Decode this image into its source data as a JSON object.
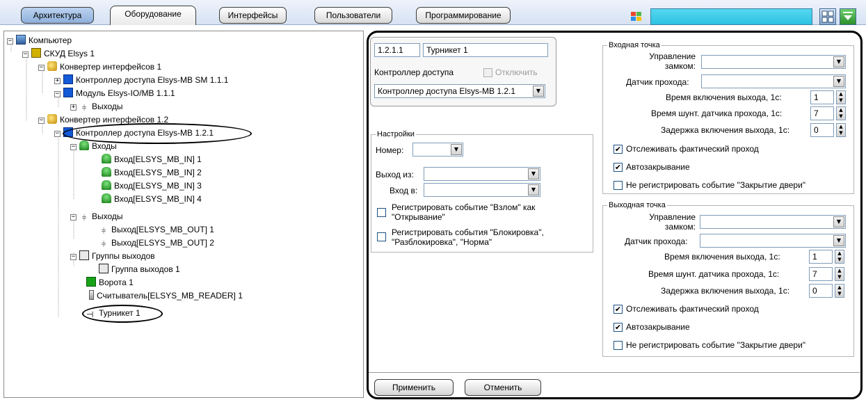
{
  "toolbar": {
    "tabs": [
      {
        "label": "Архитектура"
      },
      {
        "label": "Оборудование"
      },
      {
        "label": "Интерфейсы"
      },
      {
        "label": "Пользователи"
      },
      {
        "label": "Программирование"
      }
    ],
    "accent_color": "#2ec2e2"
  },
  "tree": {
    "items": [
      {
        "label": "Компьютер",
        "icon": "computer-icon"
      },
      {
        "label": "СКУД Elsys 1",
        "icon": "skud-icon"
      },
      {
        "label": "Конвертер интерфейсов 1",
        "icon": "converter-icon"
      },
      {
        "label": "Контроллер доступа Elsys-MB SM 1.1.1",
        "icon": "controller-icon"
      },
      {
        "label": "Модуль Elsys-IO/MB 1.1.1",
        "icon": "module-icon"
      },
      {
        "label": "Выходы",
        "icon": "outputs-icon"
      },
      {
        "label": "Конвертер интерфейсов 1.2",
        "icon": "converter-icon"
      },
      {
        "label": "Контроллер доступа Elsys-MB 1.2.1",
        "icon": "controller-icon"
      },
      {
        "label": "Входы",
        "icon": "inputs-icon"
      },
      {
        "label": "Вход[ELSYS_MB_IN] 1",
        "icon": "input-icon"
      },
      {
        "label": "Вход[ELSYS_MB_IN] 2",
        "icon": "input-icon"
      },
      {
        "label": "Вход[ELSYS_MB_IN] 3",
        "icon": "input-icon"
      },
      {
        "label": "Вход[ELSYS_MB_IN] 4",
        "icon": "input-icon"
      },
      {
        "label": "Выходы",
        "icon": "outputs-icon"
      },
      {
        "label": "Выход[ELSYS_MB_OUT] 1",
        "icon": "output-icon"
      },
      {
        "label": "Выход[ELSYS_MB_OUT] 2",
        "icon": "output-icon"
      },
      {
        "label": "Группы выходов",
        "icon": "output-groups-icon"
      },
      {
        "label": "Группа выходов 1",
        "icon": "output-group-icon"
      },
      {
        "label": "Ворота 1",
        "icon": "gate-icon"
      },
      {
        "label": "Считыватель[ELSYS_MB_READER] 1",
        "icon": "reader-icon"
      },
      {
        "label": "Турникет 1",
        "icon": "turnstile-icon"
      }
    ]
  },
  "object": {
    "id": "1.2.1.1",
    "name": "Турникет 1",
    "controller_label": "Контроллер доступа",
    "disable_label": "Отключить",
    "controller_value": "Контроллер доступа Elsys-MB 1.2.1"
  },
  "settings": {
    "title": "Настройки",
    "number_label": "Номер:",
    "number_value": "",
    "exit_from_label": "Выход из:",
    "exit_from_value": "",
    "entry_to_label": "Вход в:",
    "entry_to_value": "",
    "register_break_label": "Регистрировать событие \"Взлом\" как \"Открывание\"",
    "register_block_label": "Регистрировать события \"Блокировка\", \"Разблокировка\", \"Норма\""
  },
  "entry_point": {
    "title": "Входная точка",
    "lock_label": "Управление замком:",
    "sensor_label": "Датчик прохода:",
    "on_time_label": "Время включения выхода, 1с:",
    "on_time_value": "1",
    "shunt_time_label": "Время шунт. датчика прохода, 1с:",
    "shunt_time_value": "7",
    "delay_label": "Задержка включения выхода, 1с:",
    "delay_value": "0",
    "track_label": "Отслеживать фактический проход",
    "autoclose_label": "Автозакрывание",
    "no_register_label": "Не регистрировать событие \"Закрытие двери\""
  },
  "exit_point": {
    "title": "Выходная точка",
    "lock_label": "Управление замком:",
    "sensor_label": "Датчик прохода:",
    "on_time_label": "Время включения выхода, 1с:",
    "on_time_value": "1",
    "shunt_time_label": "Время шунт. датчика прохода, 1с:",
    "shunt_time_value": "7",
    "delay_label": "Задержка включения выхода, 1с:",
    "delay_value": "0",
    "track_label": "Отслеживать фактический проход",
    "autoclose_label": "Автозакрывание",
    "no_register_label": "Не регистрировать событие \"Закрытие двери\""
  },
  "buttons": {
    "apply": "Применить",
    "cancel": "Отменить"
  }
}
